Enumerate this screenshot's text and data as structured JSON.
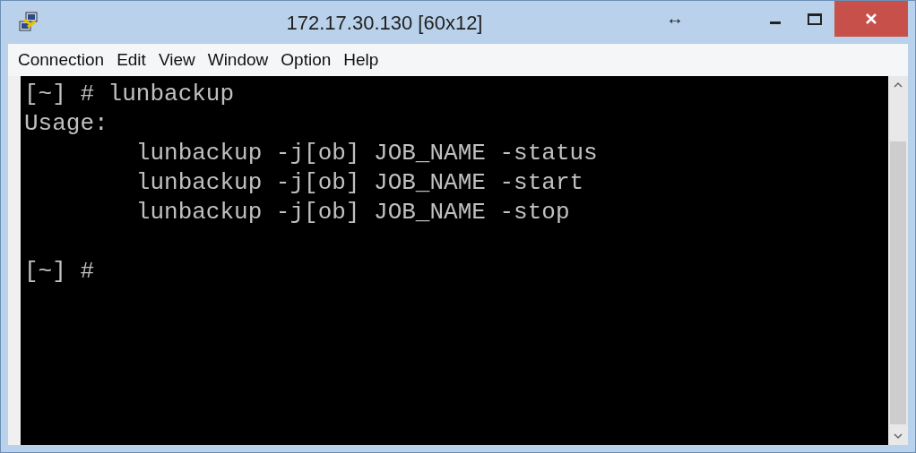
{
  "window": {
    "title": "172.17.30.130 [60x12]",
    "resize_glyph": "↔"
  },
  "menu": [
    "Connection",
    "Edit",
    "View",
    "Window",
    "Option",
    "Help"
  ],
  "terminal": {
    "lines": [
      "[~] # lunbackup",
      "Usage:",
      "        lunbackup -j[ob] JOB_NAME -status",
      "        lunbackup -j[ob] JOB_NAME -start",
      "        lunbackup -j[ob] JOB_NAME -stop"
    ],
    "prompt": "[~] #"
  }
}
